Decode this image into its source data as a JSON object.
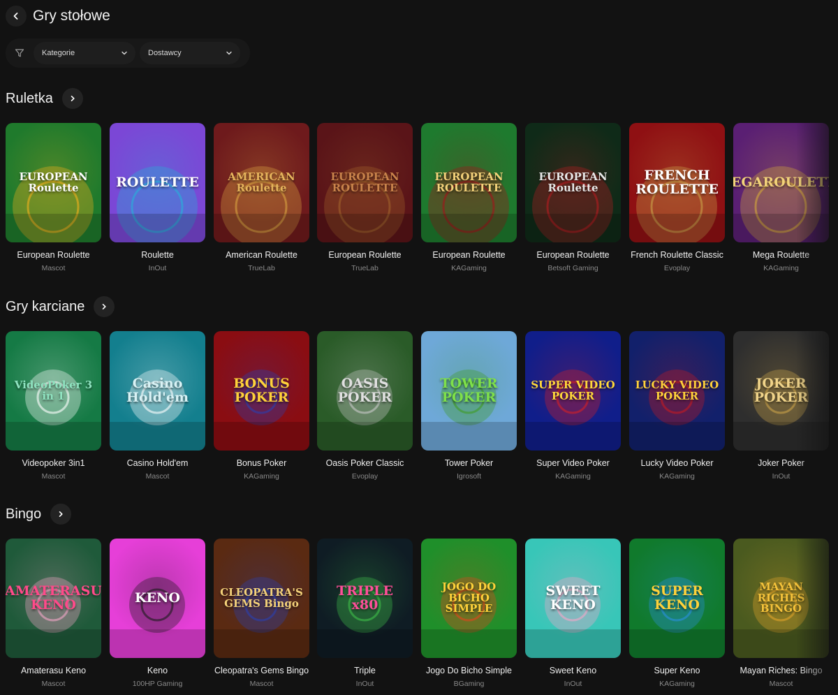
{
  "header": {
    "title": "Gry stołowe"
  },
  "filters": {
    "category_label": "Kategorie",
    "provider_label": "Dostawcy"
  },
  "icons": {
    "back": "chevron-left-icon",
    "filter": "funnel-icon",
    "dropdown": "chevron-down-icon",
    "section_arrow": "chevron-right-icon"
  },
  "sections": [
    {
      "title": "Ruletka",
      "games": [
        {
          "name": "European Roulette",
          "provider": "Mascot",
          "thumb_text": "EUROPEAN Roulette",
          "bg": "#1f7a2c",
          "accent": "#f2b01e",
          "text_color": "#ffffff"
        },
        {
          "name": "Roulette",
          "provider": "InOut",
          "thumb_text": "ROULETTE",
          "bg": "#7b47d6",
          "accent": "#26b0d8",
          "text_color": "#ffffff"
        },
        {
          "name": "American Roulette",
          "provider": "TrueLab",
          "thumb_text": "AMERICAN Roulette",
          "bg": "#6e1a1c",
          "accent": "#d9a441",
          "text_color": "#e6b45c"
        },
        {
          "name": "European Roulette",
          "provider": "TrueLab",
          "thumb_text": "EUROPEAN ROULETTE",
          "bg": "#5a1418",
          "accent": "#a0622c",
          "text_color": "#c9834b"
        },
        {
          "name": "European Roulette",
          "provider": "KAGaming",
          "thumb_text": "EUROPEAN ROULETTE",
          "bg": "#1e7a2e",
          "accent": "#a3141b",
          "text_color": "#f4d27a"
        },
        {
          "name": "European Roulette",
          "provider": "Betsoft Gaming",
          "thumb_text": "EUROPEAN Roulette",
          "bg": "#0f2a18",
          "accent": "#b51d22",
          "text_color": "#e8e8e8"
        },
        {
          "name": "French Roulette Classic",
          "provider": "Evoplay",
          "thumb_text": "FRENCH ROULETTE",
          "bg": "#8f1013",
          "accent": "#c9a24a",
          "text_color": "#ffffff"
        },
        {
          "name": "Mega Roulette",
          "provider": "KAGaming",
          "thumb_text": "MEGAROULETTE",
          "bg": "#5a1f73",
          "accent": "#d4a83a",
          "text_color": "#f2d27a"
        }
      ]
    },
    {
      "title": "Gry karciane",
      "games": [
        {
          "name": "Videopoker 3in1",
          "provider": "Mascot",
          "thumb_text": "VideoPoker 3 in 1",
          "bg": "#157a45",
          "accent": "#ffffff",
          "text_color": "#8fe3c0"
        },
        {
          "name": "Casino Hold'em",
          "provider": "Mascot",
          "thumb_text": "Casino Hold'em",
          "bg": "#137f8e",
          "accent": "#ffffff",
          "text_color": "#d8f2f5"
        },
        {
          "name": "Bonus Poker",
          "provider": "KAGaming",
          "thumb_text": "BONUS POKER",
          "bg": "#8a0d12",
          "accent": "#2a3fb0",
          "text_color": "#ffd23a"
        },
        {
          "name": "Oasis Poker Classic",
          "provider": "Evoplay",
          "thumb_text": "OASIS POKER",
          "bg": "#2a5b28",
          "accent": "#c9c9c9",
          "text_color": "#e0e0e0"
        },
        {
          "name": "Tower Poker",
          "provider": "Igrosoft",
          "thumb_text": "TOWER POKER",
          "bg": "#6ea8d8",
          "accent": "#3f9b22",
          "text_color": "#7ee04a"
        },
        {
          "name": "Super Video Poker",
          "provider": "KAGaming",
          "thumb_text": "SUPER VIDEO POKER",
          "bg": "#101e8a",
          "accent": "#d41f24",
          "text_color": "#ffd83a"
        },
        {
          "name": "Lucky Video Poker",
          "provider": "KAGaming",
          "thumb_text": "LUCKY VIDEO POKER",
          "bg": "#12206b",
          "accent": "#c41a22",
          "text_color": "#ffd23a"
        },
        {
          "name": "Joker Poker",
          "provider": "InOut",
          "thumb_text": "JOKER POKER",
          "bg": "#2e2e2e",
          "accent": "#c9a24a",
          "text_color": "#f0d48a"
        }
      ]
    },
    {
      "title": "Bingo",
      "games": [
        {
          "name": "Amaterasu Keno",
          "provider": "Mascot",
          "thumb_text": "AMATERASU KENO",
          "bg": "#1f5a3a",
          "accent": "#f4a7c8",
          "text_color": "#ff4a8a"
        },
        {
          "name": "Keno",
          "provider": "100HP Gaming",
          "thumb_text": "KENO",
          "bg": "#e63fd8",
          "accent": "#1a1a1a",
          "text_color": "#ffffff"
        },
        {
          "name": "Cleopatra's Gems Bingo",
          "provider": "Mascot",
          "thumb_text": "CLEOPATRA'S GEMS Bingo",
          "bg": "#5a2a12",
          "accent": "#2a3fb0",
          "text_color": "#f4d27a"
        },
        {
          "name": "Triple",
          "provider": "InOut",
          "thumb_text": "TRIPLE x80",
          "bg": "#0f1c24",
          "accent": "#3fbf4a",
          "text_color": "#ff4f9a"
        },
        {
          "name": "Jogo Do Bicho Simple",
          "provider": "BGaming",
          "thumb_text": "JOGO DO BICHO SIMPLE",
          "bg": "#1f8f2a",
          "accent": "#e0461c",
          "text_color": "#ffd23a"
        },
        {
          "name": "Sweet Keno",
          "provider": "InOut",
          "thumb_text": "SWEET KENO",
          "bg": "#38c6b8",
          "accent": "#f4a7c8",
          "text_color": "#ffffff"
        },
        {
          "name": "Super Keno",
          "provider": "KAGaming",
          "thumb_text": "SUPER KENO",
          "bg": "#107a2c",
          "accent": "#2a8fe0",
          "text_color": "#ffd23a"
        },
        {
          "name": "Mayan Riches: Bingo",
          "provider": "Mascot",
          "thumb_text": "MAYAN RICHES BINGO",
          "bg": "#4a5a1f",
          "accent": "#e0a42a",
          "text_color": "#f4c23a"
        }
      ]
    }
  ]
}
